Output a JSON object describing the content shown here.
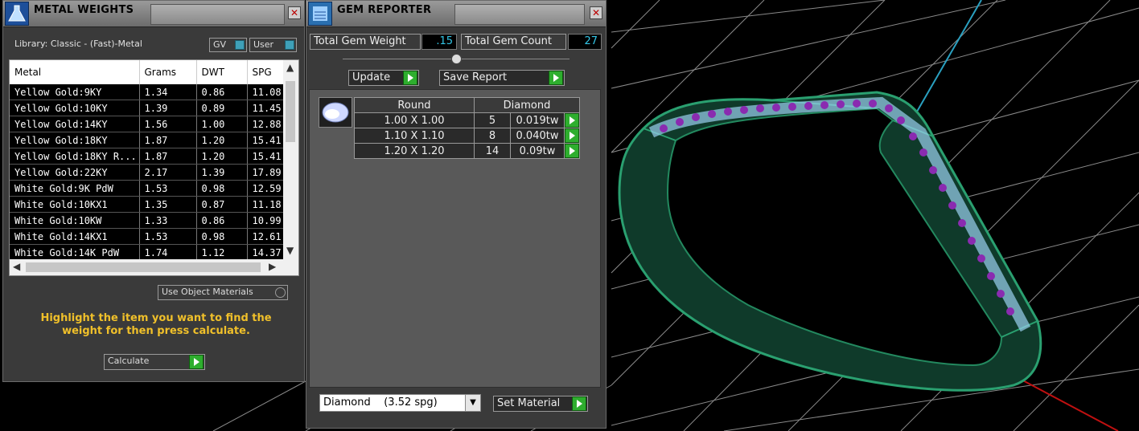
{
  "metal_weights": {
    "title": "METAL WEIGHTS",
    "library_label": "Library: Classic - (Fast)-Metal",
    "gv_label": "GV",
    "user_label": "User",
    "columns": [
      "Metal",
      "Grams",
      "DWT",
      "SPG"
    ],
    "rows": [
      [
        "Yellow Gold:9KY",
        "1.34",
        "0.86",
        "11.08"
      ],
      [
        "Yellow Gold:10KY",
        "1.39",
        "0.89",
        "11.45"
      ],
      [
        "Yellow Gold:14KY",
        "1.56",
        "1.00",
        "12.88"
      ],
      [
        "Yellow Gold:18KY",
        "1.87",
        "1.20",
        "15.41"
      ],
      [
        "Yellow Gold:18KY R...",
        "1.87",
        "1.20",
        "15.41"
      ],
      [
        "Yellow Gold:22KY",
        "2.17",
        "1.39",
        "17.89"
      ],
      [
        "White Gold:9K PdW",
        "1.53",
        "0.98",
        "12.59"
      ],
      [
        "White Gold:10KX1",
        "1.35",
        "0.87",
        "11.18"
      ],
      [
        "White Gold:10KW",
        "1.33",
        "0.86",
        "10.99"
      ],
      [
        "White Gold:14KX1",
        "1.53",
        "0.98",
        "12.61"
      ],
      [
        "White Gold:14K PdW",
        "1.74",
        "1.12",
        "14.37"
      ]
    ],
    "use_object_materials": "Use Object Materials",
    "message": "Highlight the item you want to find the weight for then press calculate.",
    "calculate_label": "Calculate"
  },
  "gem_reporter": {
    "title": "GEM REPORTER",
    "total_gem_weight_label": "Total Gem Weight",
    "total_gem_weight": ".15",
    "total_gem_count_label": "Total Gem Count",
    "total_gem_count": "27",
    "update_label": "Update",
    "save_report_label": "Save Report",
    "shape_header": "Round",
    "material_header": "Diamond",
    "gems": [
      {
        "size": "1.00 X 1.00",
        "count": "5",
        "weight": "0.019tw"
      },
      {
        "size": "1.10 X 1.10",
        "count": "8",
        "weight": "0.040tw"
      },
      {
        "size": "1.20 X 1.20",
        "count": "14",
        "weight": "0.09tw"
      }
    ],
    "material_select": "Diamond    (3.52 spg)",
    "set_material_label": "Set Material"
  },
  "colors": {
    "value_cyan": "#33c6e6",
    "message_yellow": "#f0c02a",
    "ring_green": "#1e8a5a",
    "gem_purple": "#8a2bb0"
  }
}
